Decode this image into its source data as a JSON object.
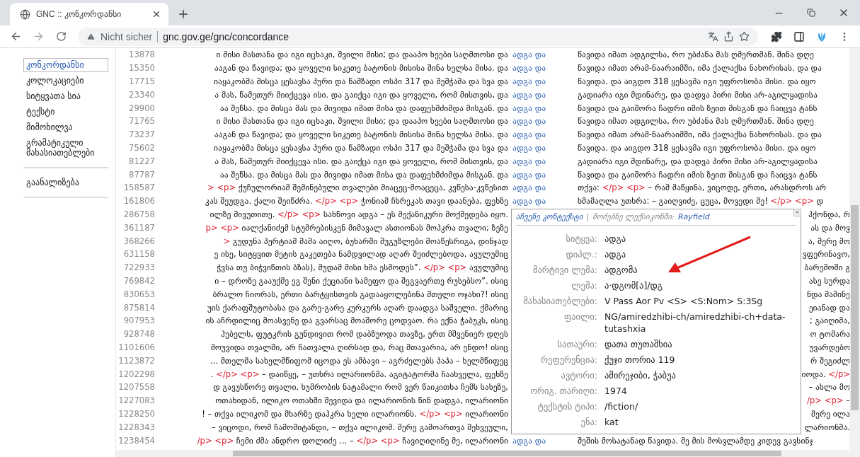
{
  "browser": {
    "tab_title": "GNC :: კონკორდანსი",
    "security": "Nicht sicher",
    "url": "gnc.gov.ge/gnc/concordance"
  },
  "sidebar": {
    "items": [
      {
        "label": "კონკორდანსი",
        "selected": true
      },
      {
        "label": "კოლოკაციები",
        "selected": false
      },
      {
        "label": "სიტყვათა სია",
        "selected": false
      },
      {
        "label": "ტექსტი",
        "selected": false
      },
      {
        "label": "მიმოხილვა",
        "selected": false
      },
      {
        "label": "გრამატიკული მახასიათებლები",
        "selected": false
      }
    ],
    "tools": [
      {
        "label": "გაანალიზება",
        "selected": false
      }
    ]
  },
  "rows": [
    {
      "kind": "full",
      "number": "13878",
      "left": [
        {
          "kind": "text",
          "text": "ი მისი მასთანა და იგი იცხაკი, შვილი მისი; და დააპო ხეები საღმთოსი და"
        }
      ],
      "keyword": "ადგა და",
      "right": [
        {
          "kind": "text",
          "text": "წავიდა იმათ ადგილსა, რო უბძანა მას ღმერთმან. შინა დღე"
        }
      ]
    },
    {
      "kind": "full",
      "number": "15350",
      "left": [
        {
          "kind": "text",
          "text": "ააგან და წავიდა; და ყოველი სიკეთე ბატონის მისისა შინა ხელსა მისა. და"
        }
      ],
      "keyword": "ადგა და",
      "right": [
        {
          "kind": "text",
          "text": "წავიდა იმათ არამ-ნაარაიმში, იმა ქალაქსა ნახორისას. და და"
        }
      ]
    },
    {
      "kind": "full",
      "number": "17715",
      "left": [
        {
          "kind": "text",
          "text": "იაყაკობმა მისცა ყესავსა პური და წამზადი ოსპი 317 და შეშჭამა და სვა და"
        }
      ],
      "keyword": "ადგა და",
      "right": [
        {
          "kind": "text",
          "text": "წავიდა. და აიგდო 318 ყესავმა იგი უფროსობა მისი. და იყო"
        }
      ]
    },
    {
      "kind": "full",
      "number": "23340",
      "left": [
        {
          "kind": "text",
          "text": "ა მას, წამეთურ მიიქცევა ისი. და გაიქცა იგი და ყოველი, რომ მისთვის, და"
        }
      ],
      "keyword": "ადგა და",
      "right": [
        {
          "kind": "text",
          "text": "გადიარა იგი მდინარე, და დადვა პირი მისი არ-აგილყადისა"
        }
      ]
    },
    {
      "kind": "full",
      "number": "29900",
      "left": [
        {
          "kind": "text",
          "text": "აა შეწსა. და მისცა მას და მივიდა იმათ მისა და დაფეხმძიმდა მისგან. და"
        }
      ],
      "keyword": "ადგა და",
      "right": [
        {
          "kind": "text",
          "text": "წავიდა და გაიშორა ჩადრი იმის ზეით მისგან და ჩაიცვა ტანს"
        }
      ]
    },
    {
      "kind": "full",
      "number": "71765",
      "left": [
        {
          "kind": "text",
          "text": "ი მისი მასთანა და იგი იცხაკი, შვილი მისი; და დააპო ხეები საღმთოსი და"
        }
      ],
      "keyword": "ადგა და",
      "right": [
        {
          "kind": "text",
          "text": "წავიდა იმათ ადგილსა, რო უბძანა მას ღმერთმან. შინა დღე"
        }
      ]
    },
    {
      "kind": "full",
      "number": "73237",
      "left": [
        {
          "kind": "text",
          "text": "ააგან და წავიდა; და ყოველი სიკეთე ბატონის მისისა შინა ხელსა მისა. და"
        }
      ],
      "keyword": "ადგა და",
      "right": [
        {
          "kind": "text",
          "text": "წავიდა იმათ არამ-ნაარაიმში, იმა ქალაქსა ნახორისას. და და"
        }
      ]
    },
    {
      "kind": "full",
      "number": "75602",
      "left": [
        {
          "kind": "text",
          "text": "იაყაკობმა მისცა ყესავსა პური და წამზადი ოსპი 317 და შეშჭამა და სვა და"
        }
      ],
      "keyword": "ადგა და",
      "right": [
        {
          "kind": "text",
          "text": "წავიდა. და აიგდო 318 ყესავმა იგი უფროსობა მისი. და იყო"
        }
      ]
    },
    {
      "kind": "full",
      "number": "81227",
      "left": [
        {
          "kind": "text",
          "text": "ა მას, წამეთურ მიიქცევა ისი. და გაიქცა იგი და ყოველი, რომ მისთვის, და"
        }
      ],
      "keyword": "ადგა და",
      "right": [
        {
          "kind": "text",
          "text": "გადიარა იგი მდინარე, და დადვა პირი მისი არ-აგილყადისა"
        }
      ]
    },
    {
      "kind": "full",
      "number": "87787",
      "left": [
        {
          "kind": "text",
          "text": "აა შეწსა. და მისცა მას და მივიდა იმათ მისა და დაფეხმძიმდა მისგან. და"
        }
      ],
      "keyword": "ადგა და",
      "right": [
        {
          "kind": "text",
          "text": "წავიდა და გაიშორა ჩადრი იმის ზეით მისგან და ჩაიცვა ტანს"
        }
      ]
    },
    {
      "kind": "full",
      "number": "158587",
      "left": [
        {
          "kind": "tag",
          "text": "> <p>"
        },
        {
          "kind": "text",
          "text": " ქუჩულორიამ შემინებული თვალები მიაცეც-მოაცეცა, კვწესა-კვწესით"
        }
      ],
      "keyword": "ადგა და",
      "right": [
        {
          "kind": "text",
          "text": "თქვა: "
        },
        {
          "kind": "tag",
          "text": "</p> <p>"
        },
        {
          "kind": "text",
          "text": " – რამ მაწყინა, ვიცოდე, ერთი, არასდროს არ"
        }
      ]
    },
    {
      "kind": "full",
      "number": "161806",
      "left": [
        {
          "kind": "text",
          "text": "კას შეუდგა. ქალი შეიწძრა. "
        },
        {
          "kind": "tag",
          "text": "</p> <p>"
        },
        {
          "kind": "text",
          "text": " ჭონიამ ჩხრეკას თავი დაანება, ფეხზე"
        }
      ],
      "keyword": "ადგა და",
      "right": [
        {
          "kind": "text",
          "text": "ხმამაღლა უთხრა: – გაიღვიძე, ცუცა, მოვედი მე! "
        },
        {
          "kind": "tag",
          "text": "</p> <p>"
        },
        {
          "kind": "text",
          "text": " დ"
        }
      ]
    },
    {
      "kind": "under_popup",
      "number": "286758",
      "left": [
        {
          "kind": "text",
          "text": "ილზე მივუთითე. "
        },
        {
          "kind": "tag",
          "text": "</p> <p>"
        },
        {
          "kind": "text",
          "text": " სახწოვი ადგა – ეს მექანიკური მოქმედება იყო."
        }
      ],
      "right": [
        {
          "kind": "text",
          "text": "ჰქონდა, რ"
        }
      ]
    },
    {
      "kind": "under_popup",
      "number": "361187",
      "left": [
        {
          "kind": "tag",
          "text": "p> <p>"
        },
        {
          "kind": "text",
          "text": " იალქანიძემ სტუმრებისკენ მიმავალ ასთიონას მოჰკრა თვალი; ზეზე"
        }
      ],
      "right": [
        {
          "kind": "text",
          "text": "ას და მოვ"
        }
      ]
    },
    {
      "kind": "under_popup",
      "number": "368266",
      "left": [
        {
          "kind": "tag",
          "text": ">"
        },
        {
          "kind": "text",
          "text": " გუდუნა პერტიამ მამა აიღო, ბუხარში მუგუზლები მოაწესრიგა, დინჯად"
        }
      ],
      "right": [
        {
          "kind": "text",
          "text": "ა, მერე მო"
        }
      ]
    },
    {
      "kind": "under_popup",
      "number": "631158",
      "left": [
        {
          "kind": "text",
          "text": "ე ისე, სიტყვით მეტის გაკეთება ნამდვილად აღარ შეიძლებოდა. ავულუმიც"
        }
      ],
      "right": [
        {
          "kind": "text",
          "text": "ვფერინავო,"
        }
      ]
    },
    {
      "kind": "under_popup",
      "number": "722933",
      "left": [
        {
          "kind": "text",
          "text": "ჭვსა თუ ბიჭვიწთის ბზას), მუდამ მისი ხმა ესმოდეს”. "
        },
        {
          "kind": "tag",
          "text": "</p> <p>"
        },
        {
          "kind": "text",
          "text": " ავულუმიც"
        }
      ],
      "right": [
        {
          "kind": "text",
          "text": "ბარემოში გ"
        }
      ]
    },
    {
      "kind": "under_popup",
      "number": "769842",
      "left": [
        {
          "kind": "text",
          "text": "ი – დროზე გააუქმე ეგ შენი ქეციანი სამეფო და შეგვაერთე რუსებსო”. ისიც"
        }
      ],
      "right": [
        {
          "kind": "text",
          "text": "ასე სურდა"
        }
      ]
    },
    {
      "kind": "under_popup",
      "number": "830653",
      "left": [
        {
          "kind": "text",
          "text": "ბრალო ჩიორას, ერთი ბარტყისთვის გადააყოლებინა მთელი ოჯახი?! ისიც"
        }
      ],
      "right": [
        {
          "kind": "text",
          "text": "ნდა მამინე"
        }
      ]
    },
    {
      "kind": "under_popup",
      "number": "875814",
      "left": [
        {
          "kind": "text",
          "text": "უის ქარაფშუტობასა და გარე-გარე კურკურს აღარ დაადგა საშველი. ქმარიც"
        }
      ],
      "right": [
        {
          "kind": "text",
          "text": "ეიანად და"
        }
      ]
    },
    {
      "kind": "under_popup",
      "number": "907953",
      "left": [
        {
          "kind": "text",
          "text": "ის აჩრდილიც მოასვენე და გვარსაც მოაშორე ცოდვაო. რა ექნა ჭაბუკს, ისიც"
        }
      ],
      "right": [
        {
          "kind": "text",
          "text": "; გაიღიმა,"
        }
      ]
    },
    {
      "kind": "under_popup",
      "number": "928748",
      "left": [
        {
          "kind": "text",
          "text": "ჰუბელს, ფუტკრის გუნდივით რომ დაბზუოდა თავზე, ერთ მშვენიერ დღეს"
        }
      ],
      "right": [
        {
          "kind": "text",
          "text": "ო ტომარა"
        }
      ]
    },
    {
      "kind": "under_popup",
      "number": "1101606",
      "left": [
        {
          "kind": "text",
          "text": "მოუვიდა თვალში, არ ჩათვალა ღირსად და, რაც მთავარია, არ ენდო! ისიც"
        }
      ],
      "right": [
        {
          "kind": "text",
          "text": "უვარდებო"
        }
      ]
    },
    {
      "kind": "under_popup",
      "number": "1123872",
      "left": [
        {
          "kind": "text",
          "text": "... მთელმა სახელმწიფომ იცოდა ეს ამბავი – აგრძელებს პაპა – ხელმწიფეც"
        }
      ],
      "right": [
        {
          "kind": "text",
          "text": "რ შეგიძლ"
        }
      ]
    },
    {
      "kind": "under_popup",
      "number": "1202298",
      "left": [
        {
          "kind": "text",
          "text": ". "
        },
        {
          "kind": "tag",
          "text": "</p> <p>"
        },
        {
          "kind": "text",
          "text": " – დაიწყე, – უთხრა ილარიონმა. აგიტატორმა ჩაახველა, ფეხზე"
        }
      ],
      "right": [
        {
          "kind": "text",
          "text": "იოდა. "
        },
        {
          "kind": "tag",
          "text": "</p>"
        }
      ]
    },
    {
      "kind": "under_popup",
      "number": "1207558",
      "left": [
        {
          "kind": "text",
          "text": "დ გავუსწორე თვალი. ხუმრობის ნატამალი რომ ვერ წაიკითხა ჩემს სახეზე,"
        }
      ],
      "right": [
        {
          "kind": "text",
          "text": "– ახლა მო"
        }
      ]
    },
    {
      "kind": "under_popup",
      "number": "1227083",
      "left": [
        {
          "kind": "text",
          "text": "ოთახიდან, ილიკო ოთახში შევიდა და ილარიონის წინ დადგა, ილარიონი"
        }
      ],
      "right": [
        {
          "kind": "tag",
          "text": "/p> <p>"
        },
        {
          "kind": "text",
          "text": " –"
        }
      ]
    },
    {
      "kind": "under_popup",
      "number": "1228250",
      "left": [
        {
          "kind": "text",
          "text": "! – თქვა ილიკომ და მხარზე დაჰკრა ხელი ილარიონს. "
        },
        {
          "kind": "tag",
          "text": "</p> <p>"
        },
        {
          "kind": "text",
          "text": " ილარიონი"
        }
      ],
      "right": [
        {
          "kind": "text",
          "text": "მერე ილა"
        }
      ]
    },
    {
      "kind": "under_popup",
      "number": "1228343",
      "left": [
        {
          "kind": "text",
          "text": "– ვიცოდი, რომ ჩამომიტანდი, – თქვა ილიკომ. მერე გამოართვა შეხვეული,"
        }
      ],
      "right": [
        {
          "kind": "text",
          "text": "ლარიონმა."
        }
      ]
    },
    {
      "kind": "full",
      "number": "1238454",
      "left": [
        {
          "kind": "tag",
          "text": "/p> <p>"
        },
        {
          "kind": "text",
          "text": " ჩემი ძმა ანდრო დოლიძე ... – "
        },
        {
          "kind": "tag",
          "text": "</p> <p>"
        },
        {
          "kind": "text",
          "text": " ჩავიღიღინე მე, ილარიონი"
        }
      ],
      "keyword": "ადგა და",
      "right": [
        {
          "kind": "text",
          "text": "შეშის მოსატანად წავიდა. მე მის მოსვლამდე კიდევ გავსინჯ"
        }
      ]
    }
  ],
  "popup": {
    "context_link": "აჩვენე კონტექსტი",
    "separator": "|",
    "dictionary_label": "მოძებნე ლექსიკონში:",
    "dictionary_link": "Rayfield",
    "close": "×",
    "fields": [
      {
        "label": "სიტყვა:",
        "value": "ადგა"
      },
      {
        "label": "დიპლ.:",
        "value": "ადგა"
      },
      {
        "label": "მარტივი ლემა:",
        "value": "ადგომა"
      },
      {
        "label": "ლემა:",
        "value": "ა·დგომ[ა]/დგ"
      },
      {
        "label": "მახასიათებლები:",
        "value": "V Pass Aor Pv <S> <S:Nom> S:3Sg"
      },
      {
        "label": "ფაილი:",
        "value": "NG/amiredzhibi-ch/amiredzhibi-ch+data-tutashxia"
      },
      {
        "label": "სათაური:",
        "value": "დათა თუთაშხია"
      },
      {
        "label": "რეფერენცია:",
        "value": "ქუჯი თორია 119"
      },
      {
        "label": "ავტორი:",
        "value": "ამირეჯიბი, ჭაბუა"
      },
      {
        "label": "ორიგ. თარიღი:",
        "value": "1974"
      },
      {
        "label": "ტექსტის ტიპი:",
        "value": "/fiction/"
      },
      {
        "label": "ენა:",
        "value": "kat"
      }
    ]
  }
}
